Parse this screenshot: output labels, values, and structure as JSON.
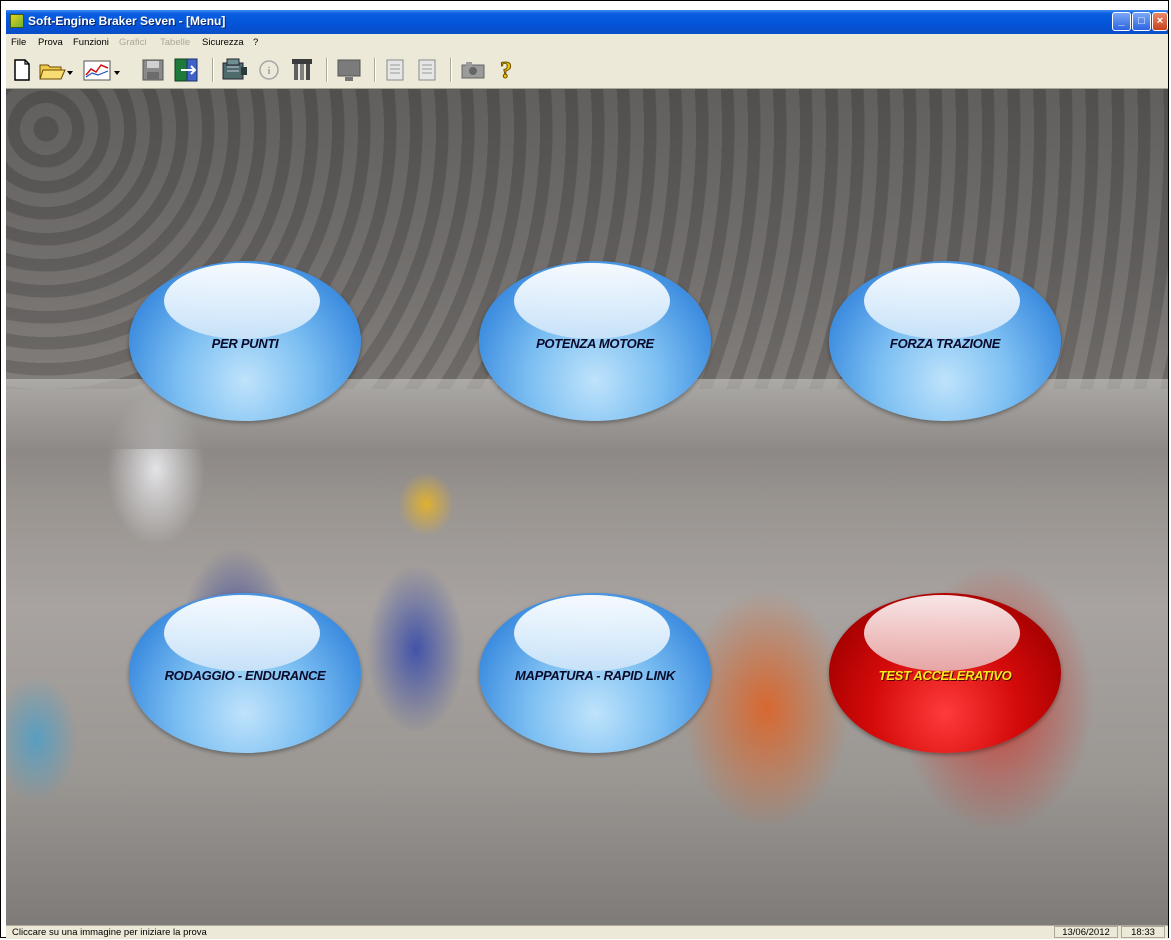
{
  "window": {
    "title": "Soft-Engine Braker Seven - [Menu]",
    "controls": {
      "minimize": "_",
      "maximize": "□",
      "close": "×"
    }
  },
  "menubar": {
    "items": [
      {
        "label": "File",
        "enabled": true
      },
      {
        "label": "Prova",
        "enabled": true
      },
      {
        "label": "Funzioni",
        "enabled": true
      },
      {
        "label": "Grafici",
        "enabled": false
      },
      {
        "label": "Tabelle",
        "enabled": false
      },
      {
        "label": "Sicurezza",
        "enabled": true
      },
      {
        "label": "?",
        "enabled": true
      }
    ]
  },
  "toolbar": {
    "buttons": [
      {
        "icon": "new-document-icon"
      },
      {
        "icon": "open-folder-icon"
      },
      {
        "icon": "graph-icon"
      },
      {
        "icon": "save-disk-icon"
      },
      {
        "icon": "exit-icon"
      },
      {
        "icon": "engine-icon"
      },
      {
        "icon": "info-icon"
      },
      {
        "icon": "settings-icon"
      },
      {
        "icon": "monitor-icon"
      },
      {
        "icon": "report-icon"
      },
      {
        "icon": "report2-icon"
      },
      {
        "icon": "camera-icon"
      },
      {
        "icon": "help-icon"
      }
    ]
  },
  "menu_buttons": [
    {
      "label": "PER PUNTI",
      "style": "blue"
    },
    {
      "label": "POTENZA MOTORE",
      "style": "blue"
    },
    {
      "label": "FORZA TRAZIONE",
      "style": "blue"
    },
    {
      "label": "RODAGGIO - ENDURANCE",
      "style": "blue"
    },
    {
      "label": "MAPPATURA - RAPID LINK",
      "style": "blue"
    },
    {
      "label": "TEST ACCELERATIVO",
      "style": "red"
    }
  ],
  "colors": {
    "titlebar": "#0453d8",
    "button_blue": "#3f8ee0",
    "button_red": "#d40a0a",
    "red_label": "#f7e81b"
  },
  "statusbar": {
    "message": "Cliccare su una immagine per iniziare la prova",
    "date": "13/06/2012",
    "time": "18:33"
  }
}
